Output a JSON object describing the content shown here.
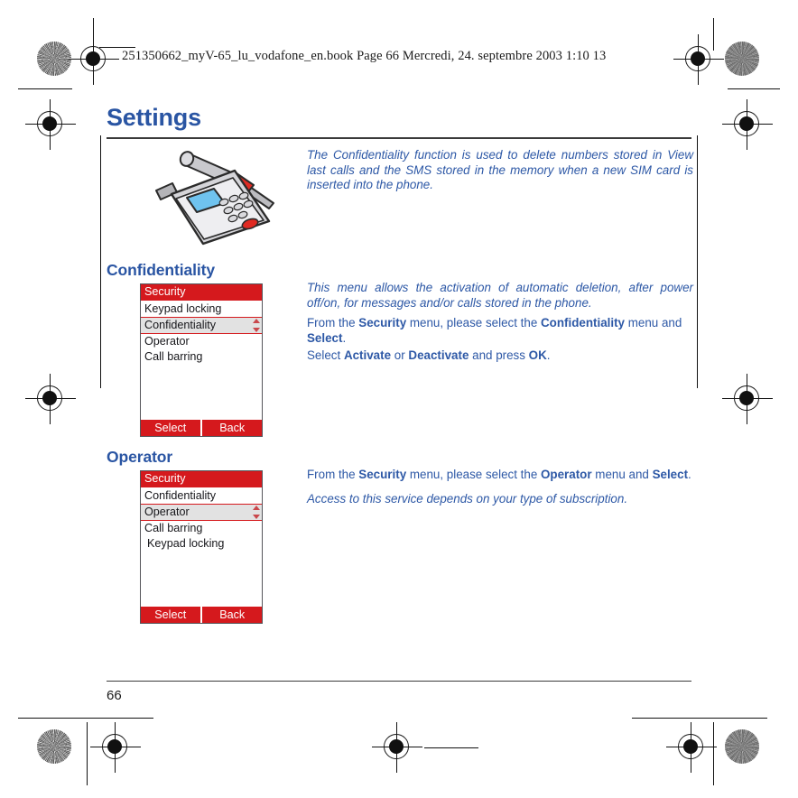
{
  "running_head": "251350662_myV-65_lu_vodafone_en.book  Page 66  Mercredi, 24. septembre 2003  1:10 13",
  "page": {
    "title": "Settings",
    "folio": "66"
  },
  "intro": {
    "text": "The Confidentiality function is used to delete numbers stored in View last calls and the SMS stored in the memory when a new SIM card is inserted into the phone."
  },
  "illustration": {
    "name": "phone-with-screwdriver-illustration"
  },
  "sections": [
    {
      "heading": "Confidentiality",
      "screen": {
        "title": "Security",
        "items": [
          {
            "label": "Keypad locking",
            "selected": false,
            "indent": false
          },
          {
            "label": "Confidentiality",
            "selected": true,
            "indent": false
          },
          {
            "label": "Operator",
            "selected": false,
            "indent": false
          },
          {
            "label": "Call barring",
            "selected": false,
            "indent": false
          }
        ],
        "softkeys": {
          "left": "Select",
          "right": "Back"
        }
      },
      "body": [
        {
          "kind": "italic",
          "runs": [
            {
              "t": "This menu allows the activation of automatic deletion, after power off/on, for messages and/or calls stored in the phone.",
              "b": false
            }
          ]
        },
        {
          "kind": "normal",
          "runs": [
            {
              "t": "From the ",
              "b": false
            },
            {
              "t": "Security",
              "b": true
            },
            {
              "t": " menu, please select the ",
              "b": false
            },
            {
              "t": "Confidentiality",
              "b": true
            },
            {
              "t": " menu and ",
              "b": false
            },
            {
              "t": "Select",
              "b": true
            },
            {
              "t": ".",
              "b": false
            }
          ]
        },
        {
          "kind": "normal",
          "runs": [
            {
              "t": "Select ",
              "b": false
            },
            {
              "t": "Activate",
              "b": true
            },
            {
              "t": " or ",
              "b": false
            },
            {
              "t": "Deactivate",
              "b": true
            },
            {
              "t": " and press ",
              "b": false
            },
            {
              "t": "OK",
              "b": true
            },
            {
              "t": ".",
              "b": false
            }
          ]
        }
      ]
    },
    {
      "heading": "Operator",
      "screen": {
        "title": "Security",
        "items": [
          {
            "label": "Confidentiality",
            "selected": false,
            "indent": false
          },
          {
            "label": "Operator",
            "selected": true,
            "indent": false
          },
          {
            "label": "Call barring",
            "selected": false,
            "indent": false
          },
          {
            "label": "Keypad locking",
            "selected": false,
            "indent": true
          }
        ],
        "softkeys": {
          "left": "Select",
          "right": "Back"
        }
      },
      "body": [
        {
          "kind": "normal",
          "runs": [
            {
              "t": "From the ",
              "b": false
            },
            {
              "t": "Security",
              "b": true
            },
            {
              "t": " menu, please select the ",
              "b": false
            },
            {
              "t": "Operator",
              "b": true
            },
            {
              "t": " menu and ",
              "b": false
            },
            {
              "t": "Select",
              "b": true
            },
            {
              "t": ".",
              "b": false
            }
          ]
        },
        {
          "kind": "italic",
          "runs": [
            {
              "t": "Access to this service depends on your type of subscription.",
              "b": false
            }
          ]
        }
      ]
    }
  ],
  "colors": {
    "heading_blue": "#2a55a3",
    "body_blue": "#2d58a6",
    "phone_red": "#d5191d",
    "selected_gray": "#e2e2e2"
  }
}
